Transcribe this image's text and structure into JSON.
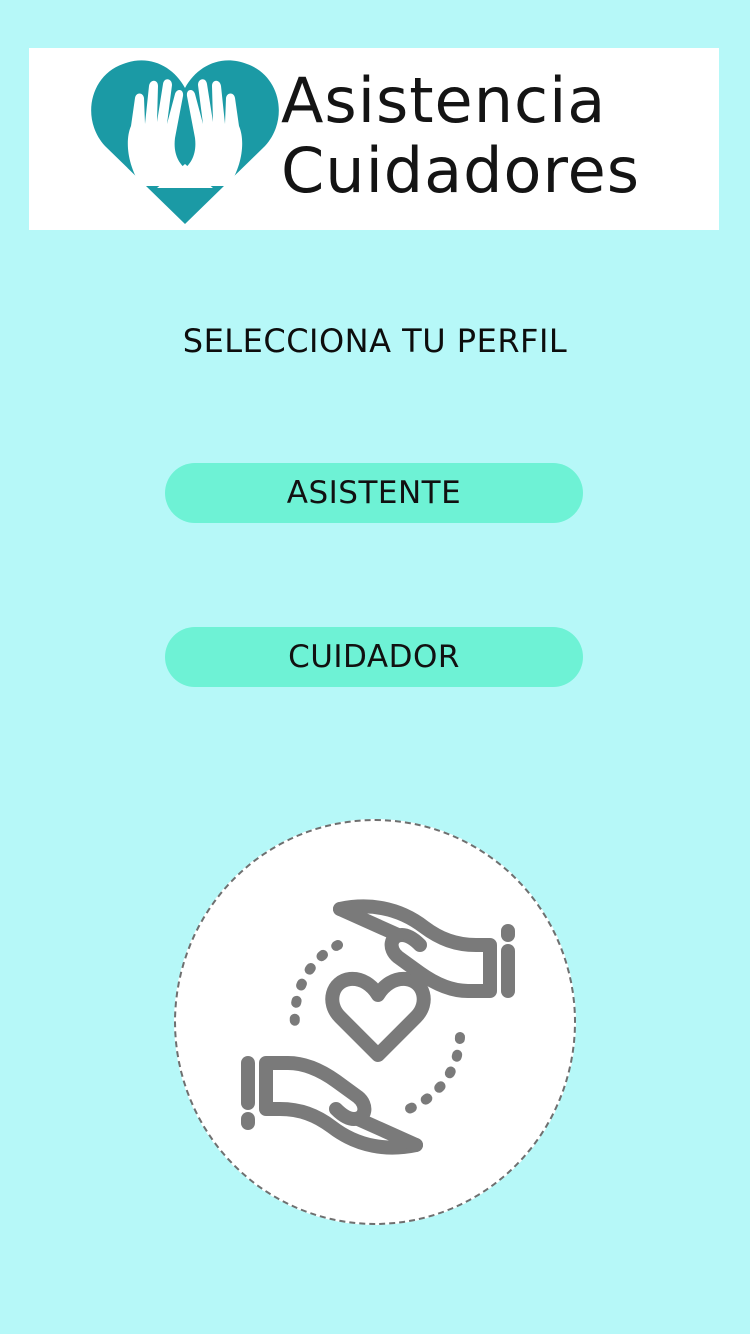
{
  "logo": {
    "line1": "Asistencia",
    "line2": "Cuidadores",
    "icon": "heart-hands-icon",
    "icon_color": "#1b9aa5"
  },
  "title": "SELECCIONA TU PERFIL",
  "buttons": {
    "asistente": "ASISTENTE",
    "cuidador": "CUIDADOR",
    "color": "#6ef2d5"
  },
  "illustration": {
    "icon": "caring-hands-heart-icon",
    "color": "#7a7a7a"
  },
  "colors": {
    "background": "#b6f8f8",
    "banner": "#ffffff"
  }
}
